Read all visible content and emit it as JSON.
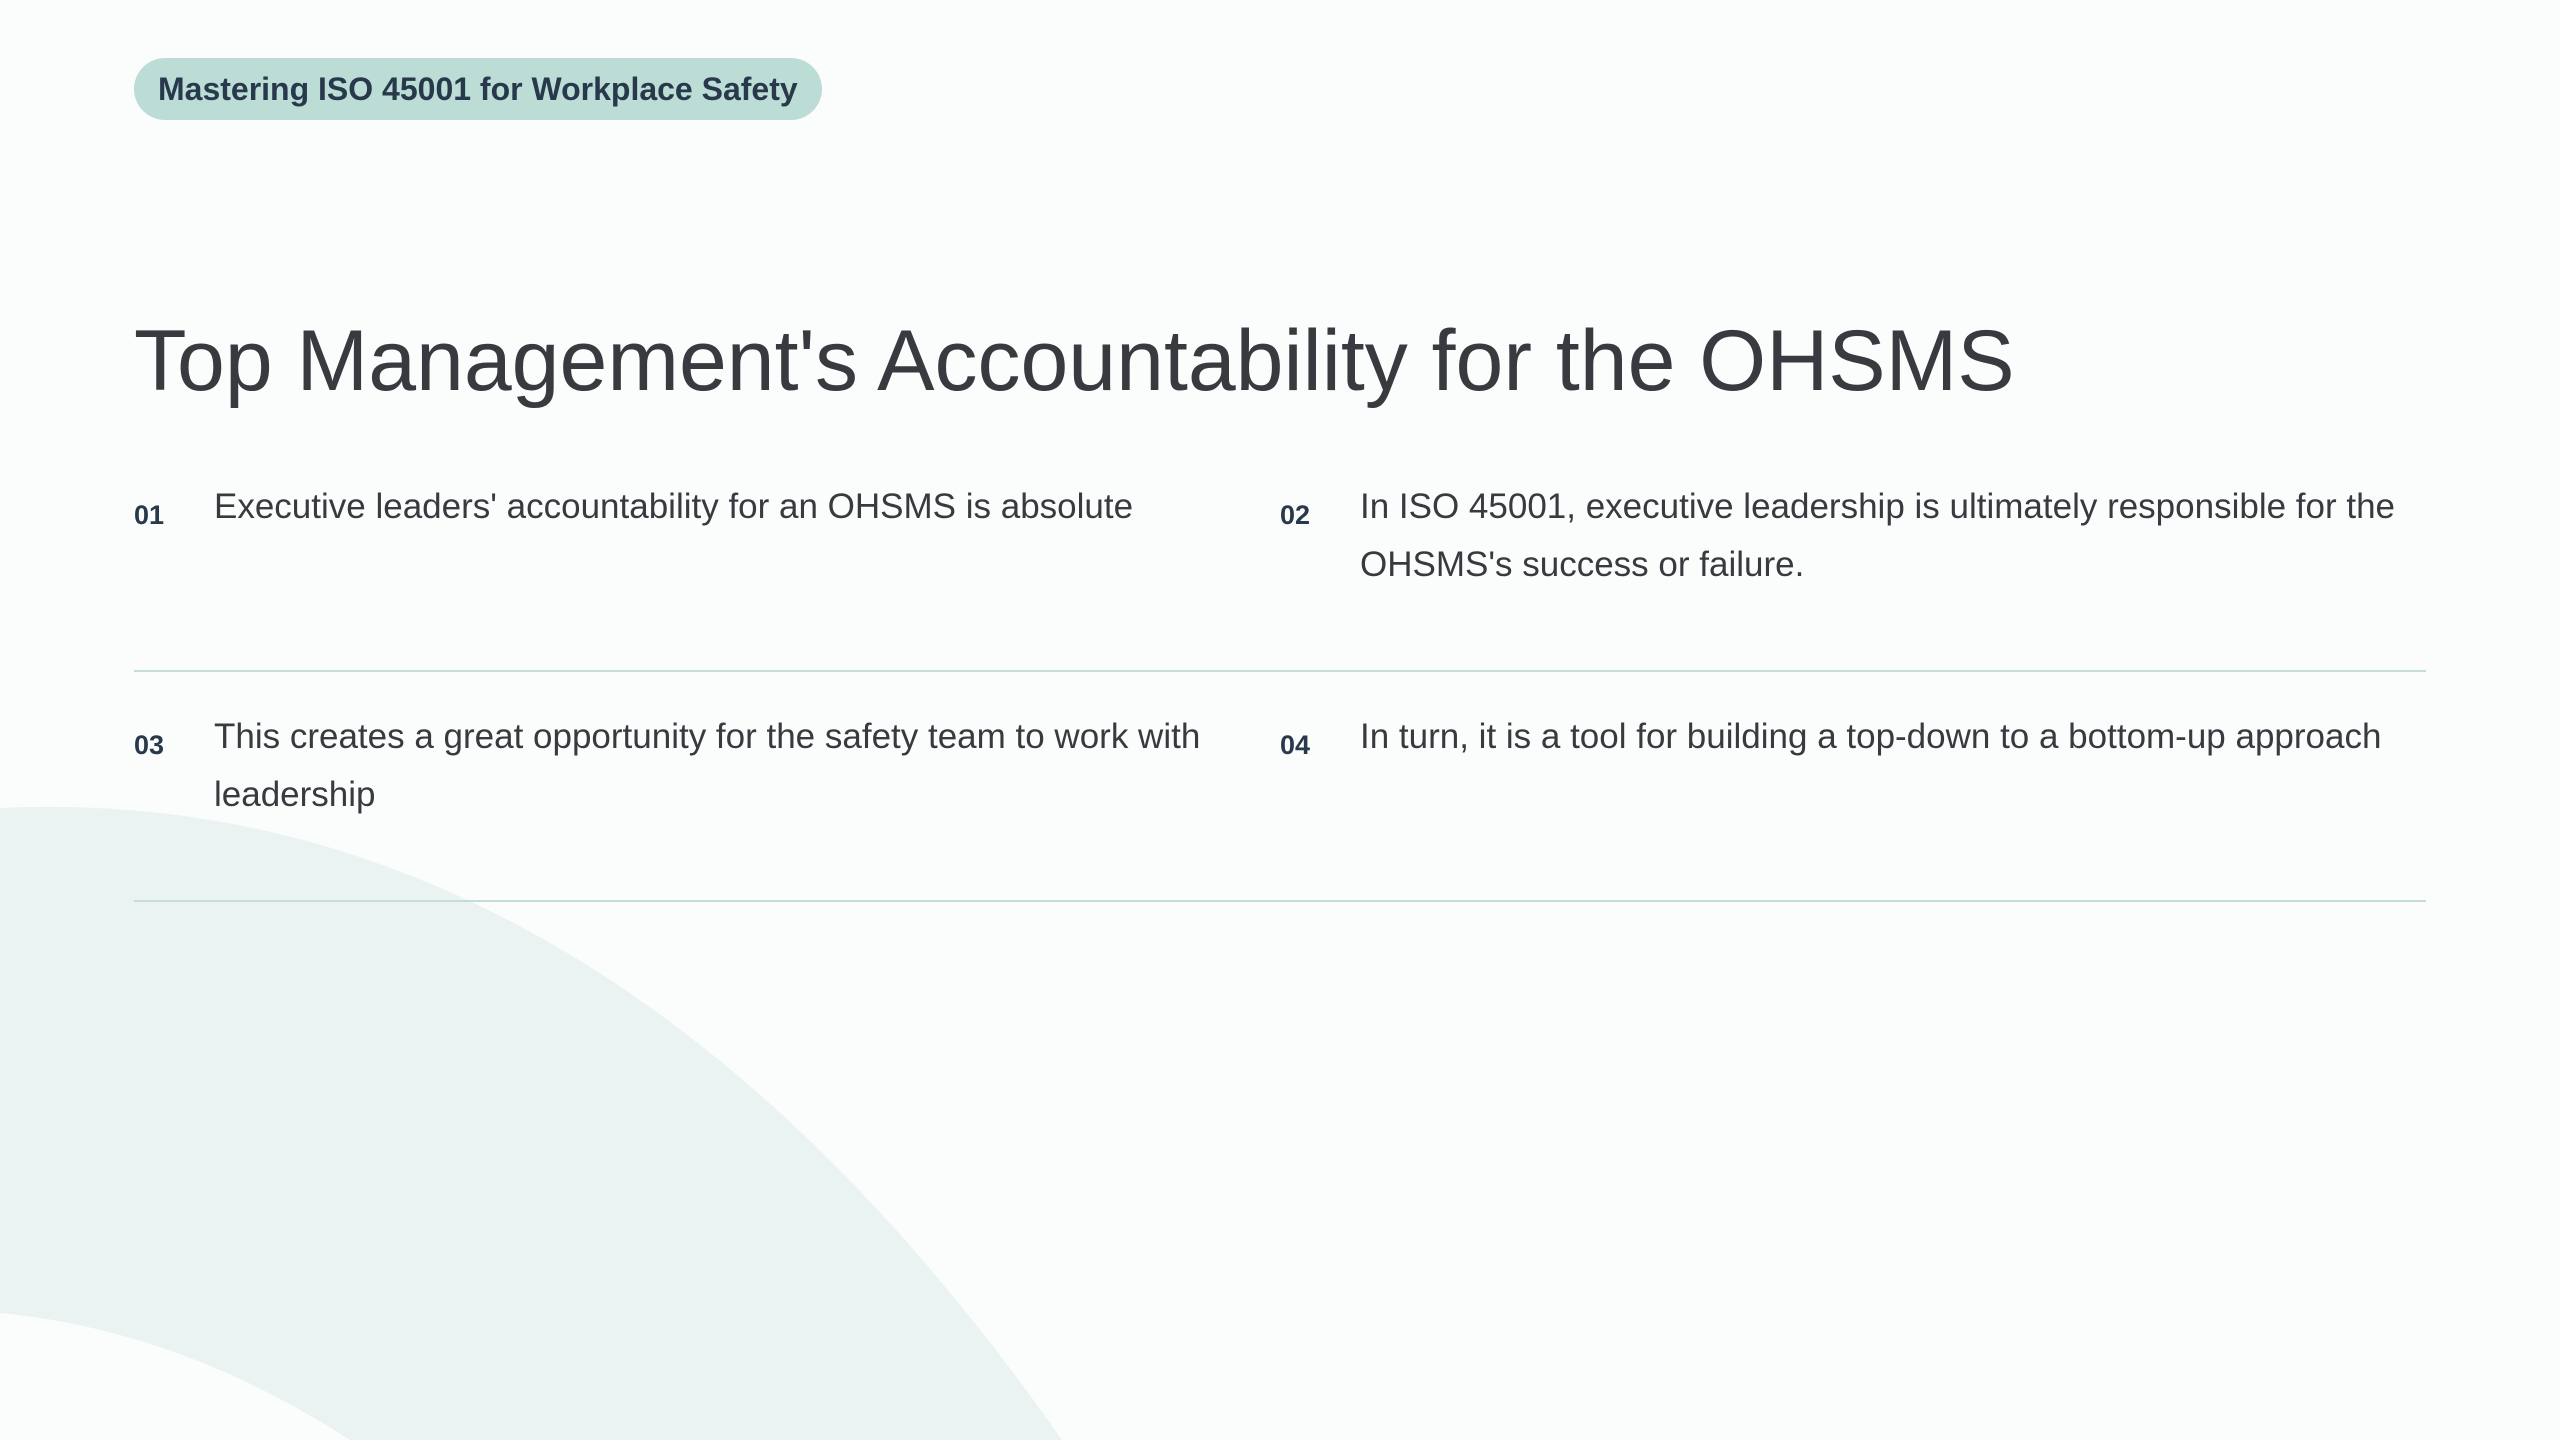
{
  "header": {
    "course_label": "Mastering ISO 45001 for Workplace Safety"
  },
  "slide": {
    "title": "Top Management's Accountability for the OHSMS"
  },
  "points": [
    {
      "number": "01",
      "text": "Executive leaders' accountability for an OHSMS is absolute"
    },
    {
      "number": "02",
      "text": "In ISO 45001, executive leadership is ultimately responsible for the OHSMS's success or failure."
    },
    {
      "number": "03",
      "text": "This creates a great opportunity for the safety team to work with leadership"
    },
    {
      "number": "04",
      "text": "In turn, it is a tool for building a top-down to a bottom-up approach"
    }
  ],
  "colors": {
    "background": "#fbfcfc",
    "pill": "#bcdcd6",
    "decorative_shape": "#eaf3f2",
    "divider": "#c4ddd9",
    "accent_text": "#27394a",
    "body_text": "#383a3f"
  }
}
